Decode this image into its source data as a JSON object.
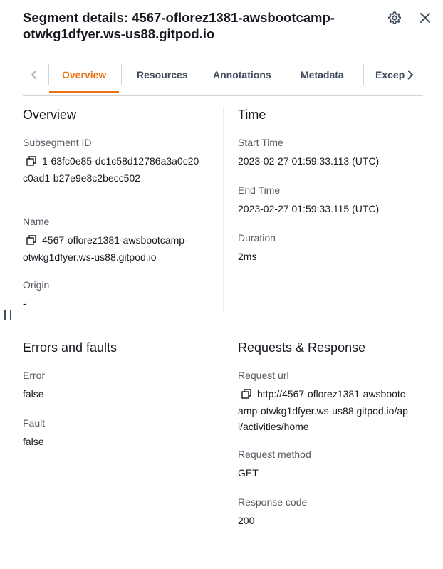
{
  "header": {
    "title": "Segment details: 4567-oflorez1381-awsbootcamp-otwkg1dfyer.ws-us88.gitpod.io",
    "settings_icon": "gear-icon",
    "close_icon": "close-icon"
  },
  "tabs": {
    "items": [
      "Overview",
      "Resources",
      "Annotations",
      "Metadata",
      "Exceptions"
    ],
    "active": "Overview",
    "active_color": "#ec7211"
  },
  "overview": {
    "title": "Overview",
    "subsegment_id_label": "Subsegment ID",
    "subsegment_id_value": "1-63fc0e85-dc1c58d12786a3a0c20c0ad1-b27e9e8c2becc502",
    "name_label": "Name",
    "name_value": "4567-oflorez1381-awsbootcamp-otwkg1dfyer.ws-us88.gitpod.io",
    "origin_label": "Origin",
    "origin_value": "-"
  },
  "time": {
    "title": "Time",
    "start_label": "Start Time",
    "start_value": "2023-02-27 01:59:33.113 (UTC)",
    "end_label": "End Time",
    "end_value": "2023-02-27 01:59:33.115 (UTC)",
    "duration_label": "Duration",
    "duration_value": "2ms"
  },
  "errors": {
    "title": "Errors and faults",
    "error_label": "Error",
    "error_value": "false",
    "fault_label": "Fault",
    "fault_value": "false"
  },
  "requests": {
    "title": "Requests & Response",
    "url_label": "Request url",
    "url_value": "http://4567-oflorez1381-awsbootcamp-otwkg1dfyer.ws-us88.gitpod.io/api/activities/home",
    "method_label": "Request method",
    "method_value": "GET",
    "code_label": "Response code",
    "code_value": "200"
  }
}
